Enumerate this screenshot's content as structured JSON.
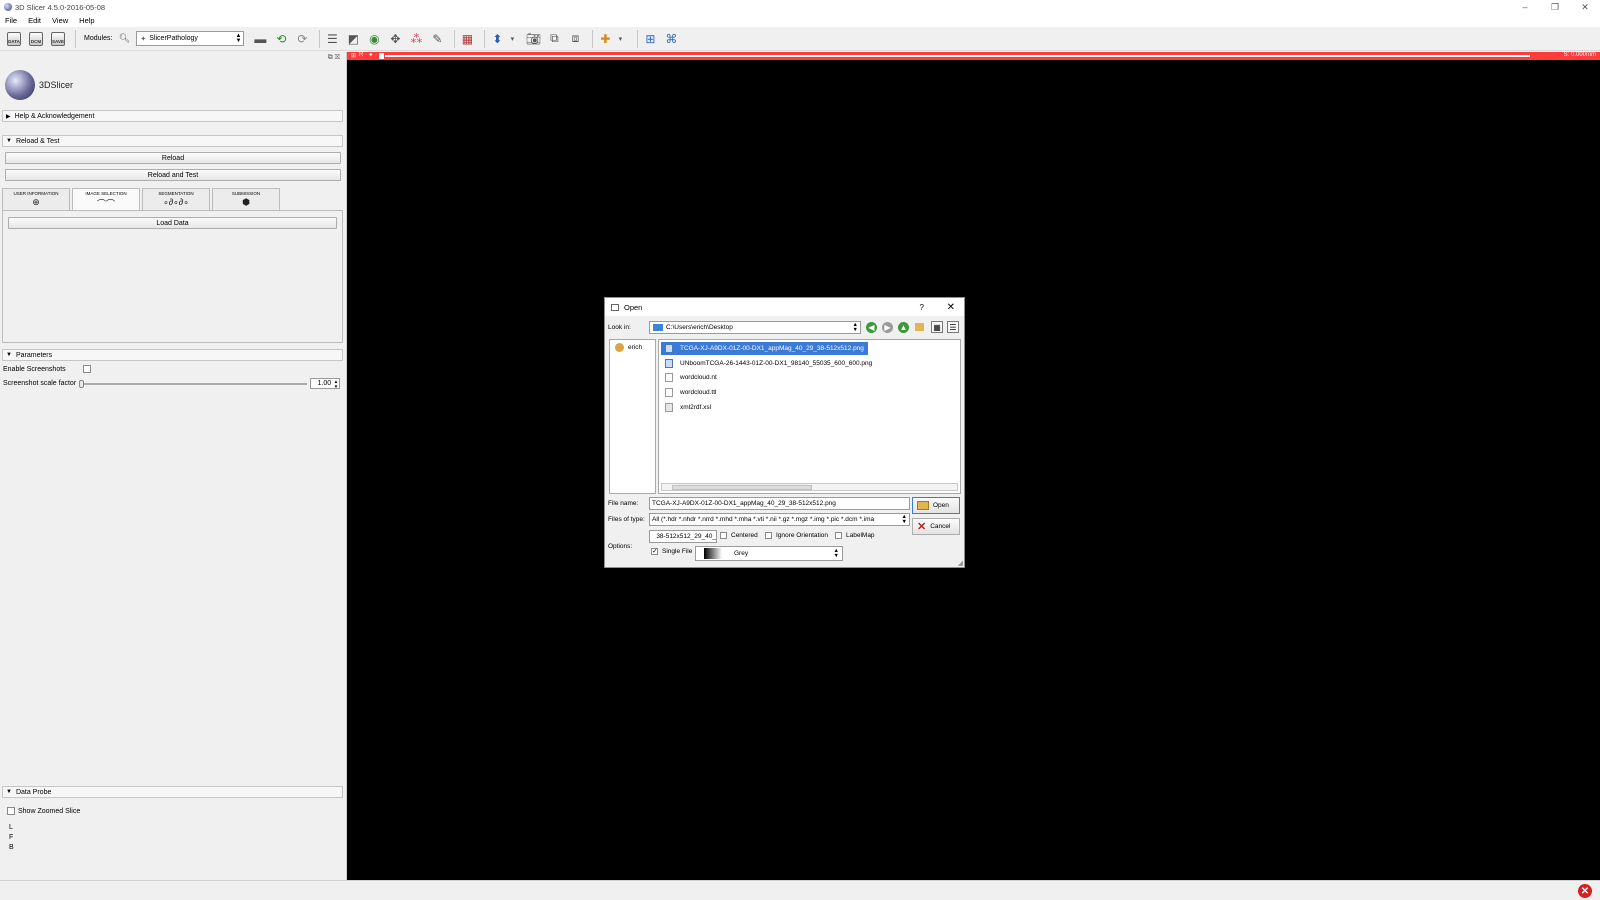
{
  "window": {
    "title": "3D Slicer 4.5.0-2016-05-08",
    "controls": [
      "–",
      "❐",
      "✕"
    ]
  },
  "menu": [
    "File",
    "Edit",
    "View",
    "Help"
  ],
  "toolbar": {
    "data_label": "DATA",
    "dcm_label": "DCM",
    "save_label": "SAVE",
    "modules_label": "Modules:",
    "module_selected": "SlicerPathology"
  },
  "left_panel": {
    "logo_text": "3DSlicer",
    "sections": {
      "help": "Help & Acknowledgement",
      "reload_test": "Reload & Test",
      "parameters": "Parameters",
      "data_probe": "Data Probe"
    },
    "buttons": {
      "reload": "Reload",
      "reload_and_test": "Reload and Test",
      "load_data": "Load Data"
    },
    "tabs": [
      {
        "label": "USER INFORMATION",
        "glyph": "⊕"
      },
      {
        "label": "IMAGE SELECTION",
        "glyph": "⌒⌒"
      },
      {
        "label": "SEGMENTATION",
        "glyph": "∘∂∘∂∘"
      },
      {
        "label": "SUBMISSION",
        "glyph": "⬢"
      }
    ],
    "parameters": {
      "enable_screenshots": "Enable Screenshots",
      "scale_factor_label": "Screenshot scale factor",
      "scale_factor_value": "1.00"
    },
    "data_probe": {
      "show_zoomed_slice": "Show Zoomed Slice",
      "coords": [
        "L",
        "F",
        "B"
      ]
    }
  },
  "viewer": {
    "slice_readout": "S: 0.000mm",
    "slice_letter": "R"
  },
  "dialog": {
    "title": "Open",
    "help": "?",
    "look_in_label": "Look in:",
    "look_in_value": "C:\\Users\\erich\\Desktop",
    "sidebar": [
      "erich"
    ],
    "files": [
      {
        "name": "TCGA-XJ-A9DX-01Z-00-DX1_appMag_40_29_38-512x512.png",
        "type": "image",
        "selected": true
      },
      {
        "name": "UNboomTCGA-26-1443-01Z-00-DX1_98140_55035_600_600.png",
        "type": "image",
        "selected": false
      },
      {
        "name": "wordcloud.nt",
        "type": "file",
        "selected": false
      },
      {
        "name": "wordcloud.ttl",
        "type": "file",
        "selected": false
      },
      {
        "name": "xml2rdf.xsl",
        "type": "xsl",
        "selected": false
      }
    ],
    "file_name_label": "File name:",
    "file_name_value": "TCGA-XJ-A9DX-01Z-00-DX1_appMag_40_29_38-512x512.png",
    "files_of_type_label": "Files of type:",
    "files_of_type_value": "All (*.hdr *.nhdr *.nrrd *.mhd *.mha *.vti *.nii *.gz *.mgz *.img *.pic *.dcm *.ima",
    "open_label": "Open",
    "cancel_label": "Cancel",
    "options_label": "Options:",
    "node_name_value": "_40_29_38-512x512",
    "options": {
      "centered": "Centered",
      "ignore_orientation": "Ignore Orientation",
      "labelmap": "LabelMap",
      "single_file": "Single File",
      "colormap": "Grey"
    }
  },
  "colors": {
    "selection": "#3a7ad8",
    "slice_red": "#ff3b3b",
    "viewer_bg": "#000000"
  }
}
